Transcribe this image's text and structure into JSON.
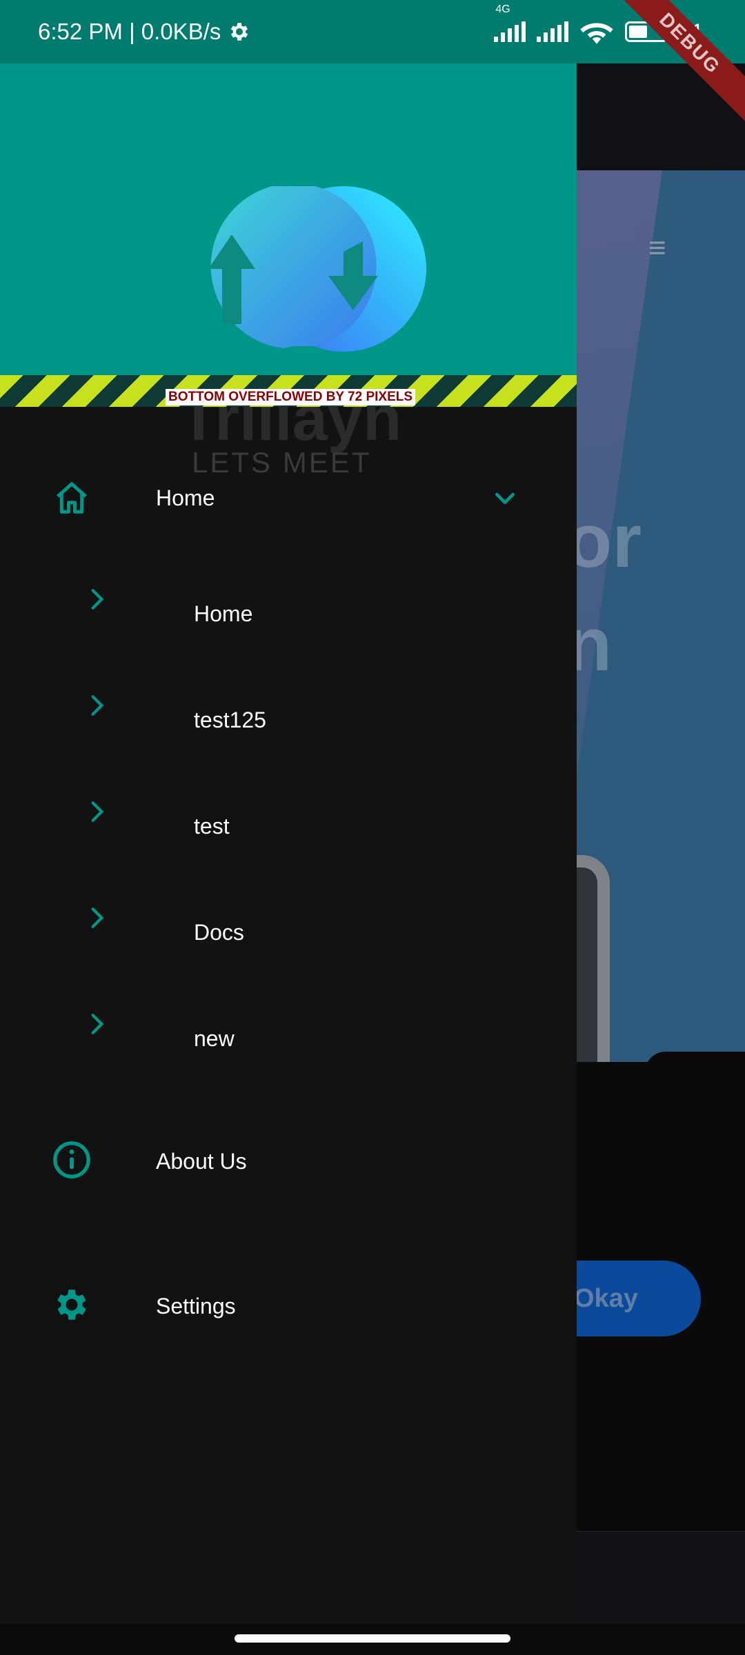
{
  "status_bar": {
    "time_speed": "6:52 PM | 0.0KB/s",
    "network": "4G",
    "battery_text": "51",
    "battery_level": 0.51,
    "debug_banner": "DEBUG"
  },
  "drawer": {
    "overflow_warning": "BOTTOM OVERFLOWED BY 72 PIXELS",
    "brand_name": "Trillayn",
    "brand_tagline": "LETS MEET",
    "menu": {
      "home": {
        "label": "Home",
        "icon": "home-icon",
        "expanded": true
      },
      "subitems": [
        {
          "label": "Home"
        },
        {
          "label": "test125"
        },
        {
          "label": "test"
        },
        {
          "label": "Docs"
        },
        {
          "label": "new"
        }
      ],
      "about": {
        "label": "About Us",
        "icon": "info-icon"
      },
      "settings": {
        "label": "Settings",
        "icon": "gear-icon"
      }
    }
  },
  "background": {
    "hero_text": "or\nn",
    "okay_button": "Okay"
  },
  "colors": {
    "accent": "#009688",
    "status_bar": "#007b70",
    "drawer_bg": "#121212",
    "overflow_warning": "#8a0000"
  }
}
